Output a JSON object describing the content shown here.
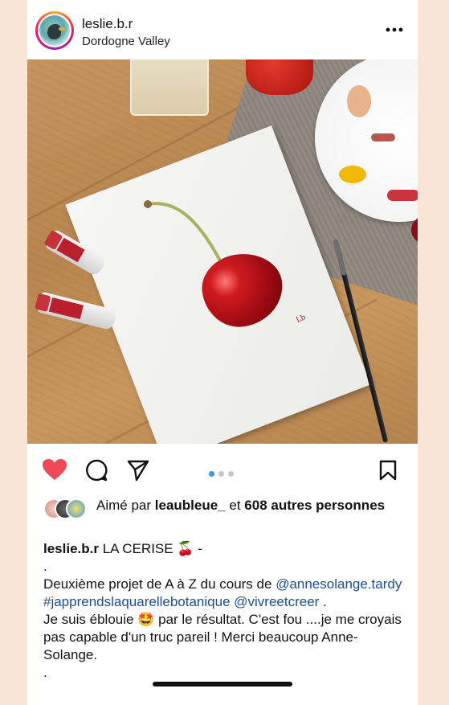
{
  "post": {
    "username": "leslie.b.r",
    "location": "Dordogne Valley",
    "more_icon": "more-horizontal-icon"
  },
  "photo": {
    "description_icons": [
      "cherry-painting",
      "paint-tube",
      "brush",
      "palette-plate"
    ]
  },
  "actions": {
    "like": "heart-icon",
    "comment": "comment-icon",
    "share": "send-icon",
    "save": "bookmark-icon",
    "carousel_total": 3,
    "carousel_active": 1,
    "liked_color": "#ed4956",
    "active_dot_color": "#3897f0"
  },
  "likes": {
    "prefix": "Aimé par",
    "user": "leaubleue_",
    "connector": "et",
    "count": "608 autres personnes"
  },
  "caption": {
    "username": "leslie.b.r",
    "title": "LA CERISE",
    "title_emoji": "🍒",
    "title_suffix": "-",
    "dot1": ".",
    "line1": "Deuxième projet de A à Z du cours de",
    "mention1": "@annesolange.tardy",
    "hashtag1": "#japprendslaquarellebotanique",
    "mention2": "@vivreetcreer",
    "after_mention2": ".",
    "line3_a": "Je suis éblouie",
    "line3_emoji": "🤩",
    "line3_b": "par le résultat. C'est fou ....je me croyais pas capable d'un truc pareil ! Merci beaucoup Anne-Solange.",
    "dot2": "."
  },
  "colors": {
    "page_background": "#f8e5d6",
    "link": "#1d4e8a"
  }
}
